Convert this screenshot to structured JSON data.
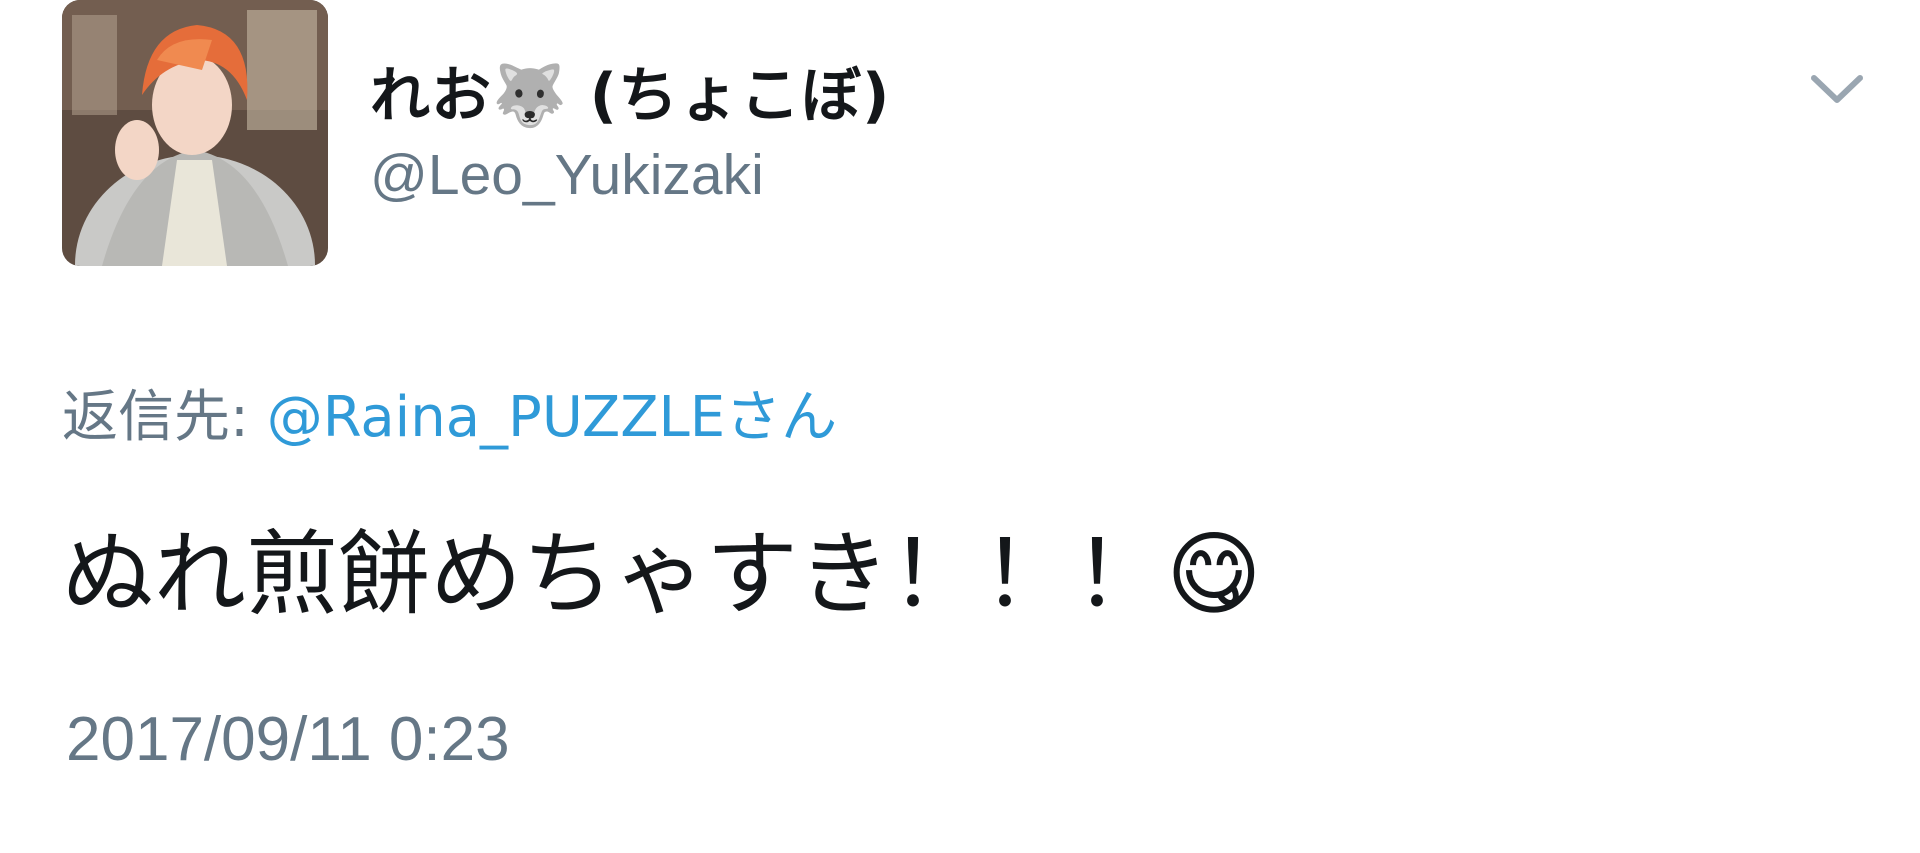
{
  "tweet": {
    "avatar_icon": "user-avatar-photo",
    "display_name": "れお🐺 (ちょこぼ)",
    "handle": "@Leo_Yukizaki",
    "menu_icon": "chevron-down-icon",
    "reply_label": "返信先:",
    "reply_user": "@Raina_PUZZLEさん",
    "text": "ぬれ煎餅めちゃすき！！！😋",
    "timestamp": "2017/09/11 0:23"
  },
  "colors": {
    "text": "#14171a",
    "secondary": "#657786",
    "link": "#2f9ad8",
    "background": "#ffffff"
  }
}
